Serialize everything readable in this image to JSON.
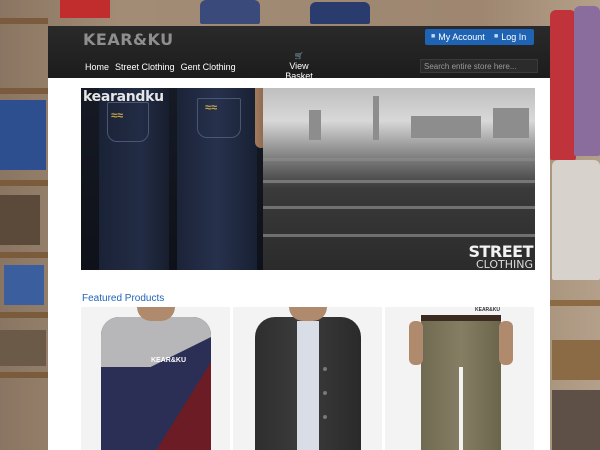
{
  "header": {
    "logo": "KEAR&KU",
    "my_account": "My Account",
    "log_in": "Log In"
  },
  "nav": {
    "items": [
      "Home",
      "Street Clothing",
      "Gent Clothing"
    ],
    "basket": "View Basket"
  },
  "search": {
    "placeholder": "Search entire store here..."
  },
  "hero": {
    "brand": "kearandku",
    "tagline_line1": "STREET",
    "tagline_line2": "CLOTHING"
  },
  "featured": {
    "title": "Featured Products",
    "products": [
      {
        "name": "tee",
        "print": "KEAR&KU"
      },
      {
        "name": "jacket"
      },
      {
        "name": "chinos",
        "print": "KEAR&KU"
      }
    ]
  },
  "colors": {
    "accent": "#1f63b5",
    "header_bg": "#1c1c1c",
    "page_bg": "#ffffff"
  }
}
